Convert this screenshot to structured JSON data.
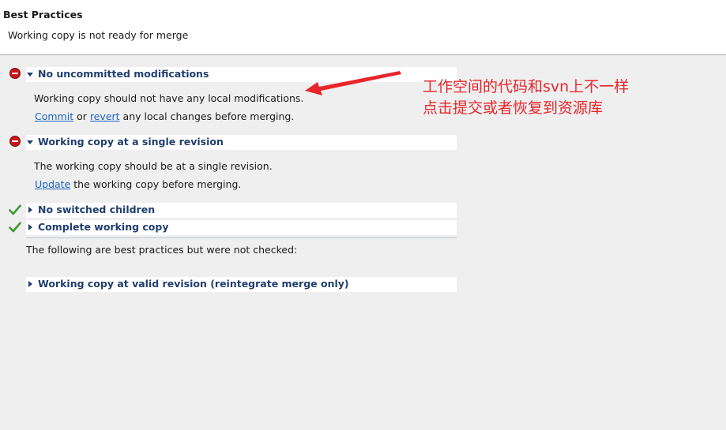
{
  "header": {
    "title": "Best Practices",
    "status": "Working copy is not ready for merge"
  },
  "checks": [
    {
      "title": "No uncommitted modifications",
      "state": "error",
      "expanded": true,
      "description": "Working copy should not have any local modifications.",
      "action": {
        "link1": "Commit",
        "sep": "or",
        "link2": "revert",
        "rest": "any local changes before merging."
      }
    },
    {
      "title": "Working copy at a single revision",
      "state": "error",
      "expanded": true,
      "description": "The working copy should be at a single revision.",
      "action": {
        "link1": "Update",
        "rest": "the working copy before merging."
      }
    },
    {
      "title": "No switched children",
      "state": "ok",
      "expanded": false
    },
    {
      "title": "Complete working copy",
      "state": "ok",
      "expanded": false
    }
  ],
  "unchecked": {
    "intro": "The following are best practices but were not checked:",
    "items": [
      {
        "title": "Working copy at valid revision (reintegrate merge only)",
        "expanded": false
      }
    ]
  },
  "annotation": {
    "line1": "工作空间的代码和svn上不一样",
    "line2": "点击提交或者恢复到资源库",
    "color": "#e8262a"
  }
}
